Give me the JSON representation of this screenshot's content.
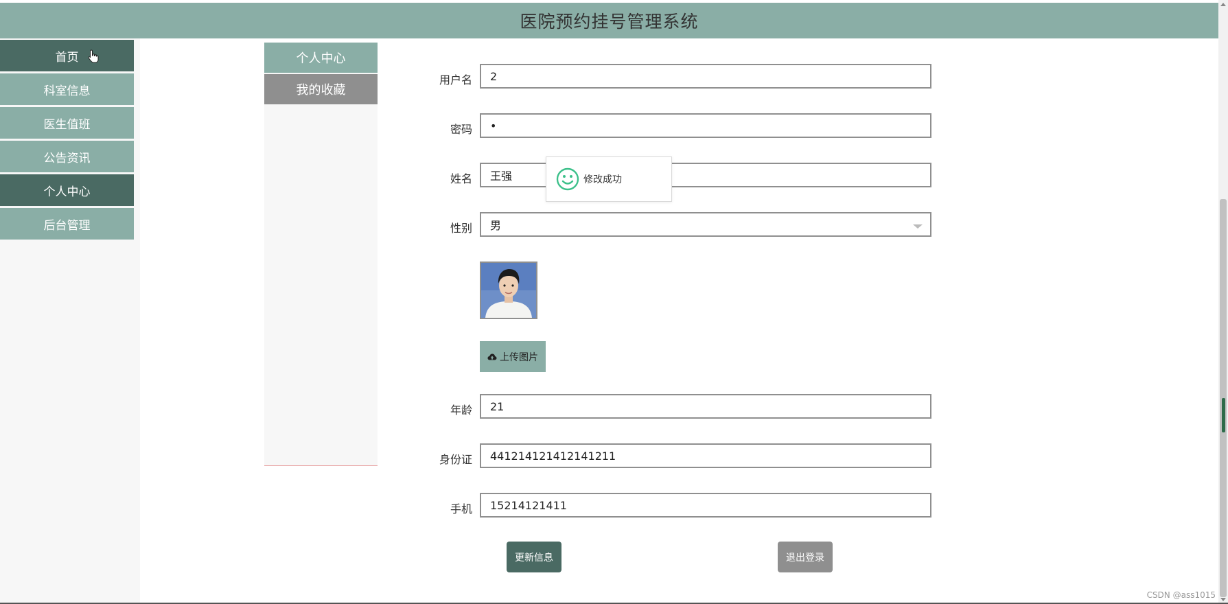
{
  "app": {
    "title": "医院预约挂号管理系统"
  },
  "nav": {
    "items": [
      {
        "label": "首页",
        "active": true
      },
      {
        "label": "科室信息",
        "active": false
      },
      {
        "label": "医生值班",
        "active": false
      },
      {
        "label": "公告资讯",
        "active": false
      },
      {
        "label": "个人中心",
        "active": true
      },
      {
        "label": "后台管理",
        "active": false
      }
    ]
  },
  "subnav": {
    "items": [
      {
        "label": "个人中心"
      },
      {
        "label": "我的收藏"
      }
    ]
  },
  "form": {
    "username": {
      "label": "用户名",
      "value": "2"
    },
    "password": {
      "label": "密码",
      "value": "•"
    },
    "name": {
      "label": "姓名",
      "value": "王强"
    },
    "gender": {
      "label": "性别",
      "value": "男"
    },
    "upload_label": "上传图片",
    "age": {
      "label": "年龄",
      "value": "21"
    },
    "id_card": {
      "label": "身份证",
      "value": "441214121412141211"
    },
    "phone": {
      "label": "手机",
      "value": "15214121411"
    },
    "update_label": "更新信息",
    "logout_label": "退出登录"
  },
  "toast": {
    "text": "修改成功"
  },
  "watermark": "CSDN @ass1015",
  "colors": {
    "header_bg": "#8aaea6",
    "nav_active": "#4a6a63",
    "gray_button": "#8f8f8f",
    "success_icon": "#3cc08a"
  },
  "icons": {
    "cursor": "hand-pointer-icon",
    "upload": "cloud-upload-icon",
    "toast": "smiley-success-icon",
    "select": "chevron-down-icon"
  }
}
